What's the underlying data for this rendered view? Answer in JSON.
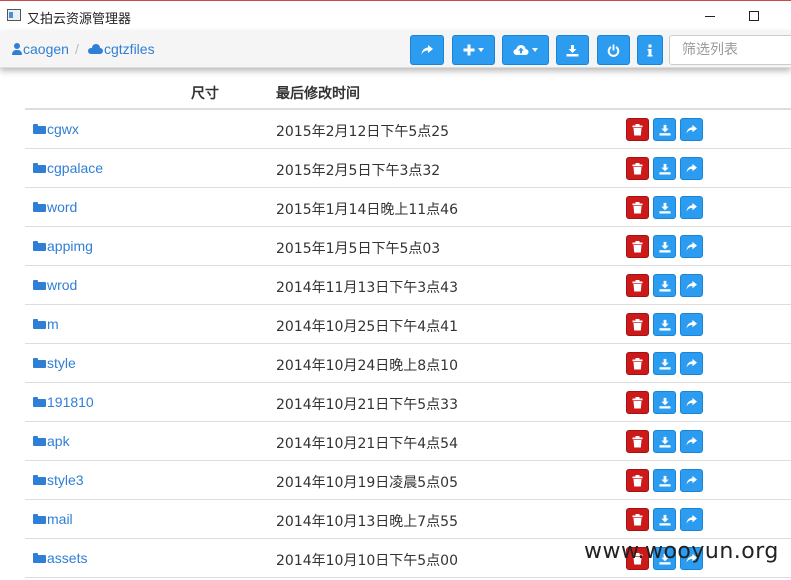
{
  "window": {
    "title": "又拍云资源管理器"
  },
  "breadcrumb": {
    "user": "caogen",
    "separator": "/",
    "bucket": "cgtzfiles"
  },
  "toolbar": {
    "filter_placeholder": "筛选列表"
  },
  "table": {
    "columns": {
      "name": "",
      "size": "尺寸",
      "mtime": "最后修改时间"
    },
    "rows": [
      {
        "name": "cgwx",
        "mtime": "2015年2月12日下午5点25"
      },
      {
        "name": "cgpalace",
        "mtime": "2015年2月5日下午3点32"
      },
      {
        "name": "word",
        "mtime": "2015年1月14日晚上11点46"
      },
      {
        "name": "appimg",
        "mtime": "2015年1月5日下午5点03"
      },
      {
        "name": "wrod",
        "mtime": "2014年11月13日下午3点43"
      },
      {
        "name": "m",
        "mtime": "2014年10月25日下午4点41"
      },
      {
        "name": "style",
        "mtime": "2014年10月24日晚上8点10"
      },
      {
        "name": "191810",
        "mtime": "2014年10月21日下午5点33"
      },
      {
        "name": "apk",
        "mtime": "2014年10月21日下午4点54"
      },
      {
        "name": "style3",
        "mtime": "2014年10月19日凌晨5点05"
      },
      {
        "name": "mail",
        "mtime": "2014年10月13日晚上7点55"
      },
      {
        "name": "assets",
        "mtime": "2014年10月10日下午5点00"
      }
    ]
  },
  "watermark": "www.wooyun.org",
  "colors": {
    "primary": "#2c9cf0",
    "danger": "#cc1a1a",
    "link": "#2f7fd6"
  }
}
